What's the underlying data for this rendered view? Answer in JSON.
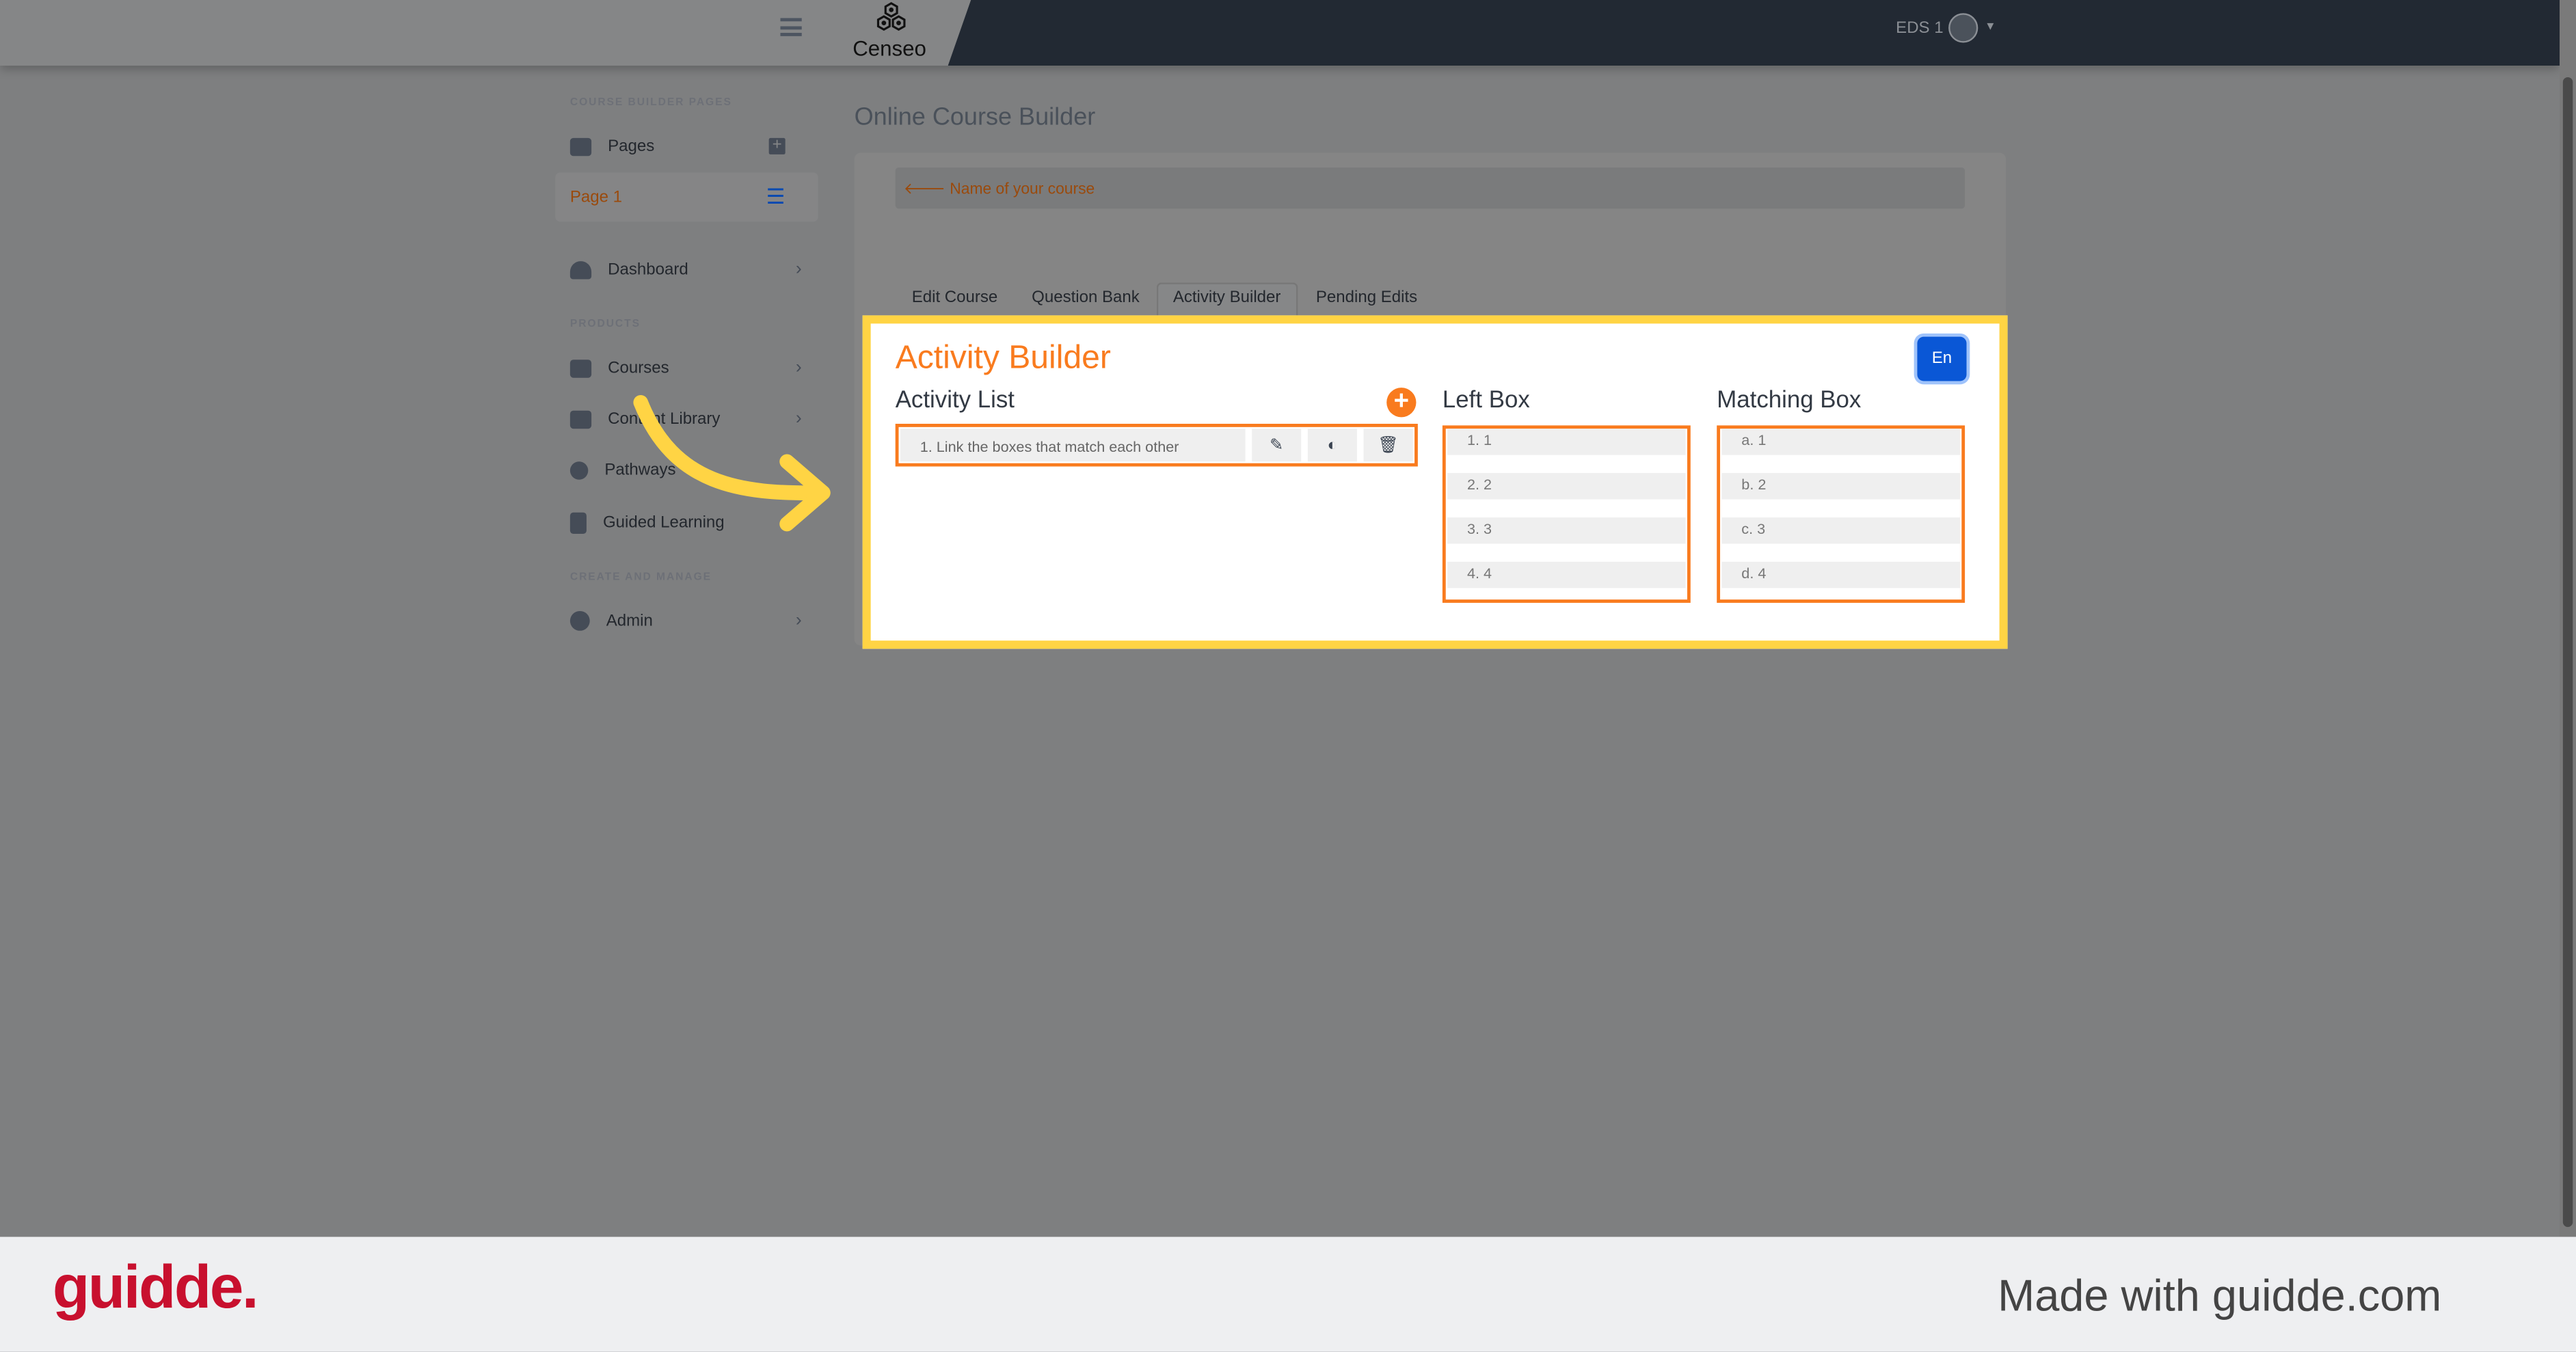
{
  "header": {
    "logo": "Censeo",
    "user": "EDS 1",
    "menu_icon": "hamburger-icon",
    "avatar_icon": "user-circle-icon"
  },
  "sidebar": {
    "section1": "COURSE BUILDER PAGES",
    "pages": "Pages",
    "page1": "Page 1",
    "dashboard": "Dashboard",
    "section2": "PRODUCTS",
    "courses": "Courses",
    "content_library": "Content Library",
    "pathways": "Pathways",
    "guided_learning": "Guided Learning",
    "section3": "CREATE AND MANAGE",
    "admin": "Admin"
  },
  "main": {
    "title": "Online Course Builder",
    "course_name": "Name of your course",
    "tabs": [
      {
        "label": "Edit Course"
      },
      {
        "label": "Question Bank"
      },
      {
        "label": "Activity Builder",
        "active": true
      },
      {
        "label": "Pending Edits"
      }
    ]
  },
  "builder": {
    "title": "Activity Builder",
    "lang": "En",
    "activity_list": "Activity List",
    "activities": [
      "1. Link the boxes that match each other"
    ],
    "left_box_title": "Left Box",
    "left_box": [
      "1. 1",
      "2. 2",
      "3. 3",
      "4. 4"
    ],
    "matching_box_title": "Matching Box",
    "matching_box": [
      "a. 1",
      "b. 2",
      "c. 3",
      "d. 4"
    ]
  },
  "footer": {
    "logo": "guidde.",
    "made_with": "Made with guidde.com"
  },
  "colors": {
    "accent": "#f97b1e",
    "highlight": "#ffd444",
    "button": "#0a57d6",
    "topbar": "#222933",
    "guidde": "#c8102e"
  }
}
